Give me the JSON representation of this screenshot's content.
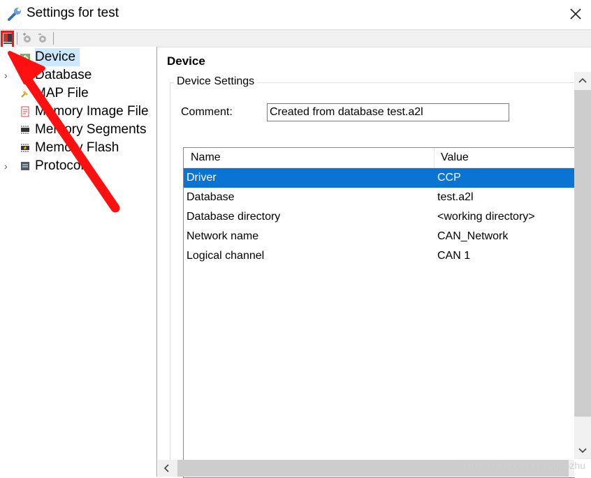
{
  "window": {
    "title": "Settings for test"
  },
  "tree": {
    "items": [
      {
        "label": "Device",
        "icon": "device-icon",
        "expandable": false,
        "selected": true
      },
      {
        "label": "Database",
        "icon": "database-icon",
        "expandable": true,
        "selected": false
      },
      {
        "label": "MAP File",
        "icon": "pin-icon",
        "expandable": false,
        "selected": false
      },
      {
        "label": "Memory Image File",
        "icon": "memory-image-icon",
        "expandable": false,
        "selected": false
      },
      {
        "label": "Memory Segments",
        "icon": "chip-icon",
        "expandable": false,
        "selected": false
      },
      {
        "label": "Memory Flash",
        "icon": "flash-chip-icon",
        "expandable": false,
        "selected": false
      },
      {
        "label": "Protocol",
        "icon": "protocol-icon",
        "expandable": true,
        "selected": false
      }
    ]
  },
  "main": {
    "page_title": "Device",
    "group_title": "Device Settings",
    "comment_label": "Comment:",
    "comment_value": "Created from database test.a2l",
    "table": {
      "headers": {
        "name": "Name",
        "value": "Value"
      },
      "rows": [
        {
          "name": "Driver",
          "value": "CCP",
          "selected": true
        },
        {
          "name": "Database",
          "value": "test.a2l",
          "selected": false
        },
        {
          "name": "Database directory",
          "value": "<working directory>",
          "selected": false
        },
        {
          "name": "Network name",
          "value": "CAN_Network",
          "selected": false
        },
        {
          "name": "Logical channel",
          "value": "CAN 1",
          "selected": false
        }
      ]
    }
  },
  "watermark": "https://blog.csdn.net/qfmzhu",
  "colors": {
    "selection_tree": "#cce8ff",
    "selection_table": "#0a74d4",
    "annotation": "#ff1010"
  }
}
